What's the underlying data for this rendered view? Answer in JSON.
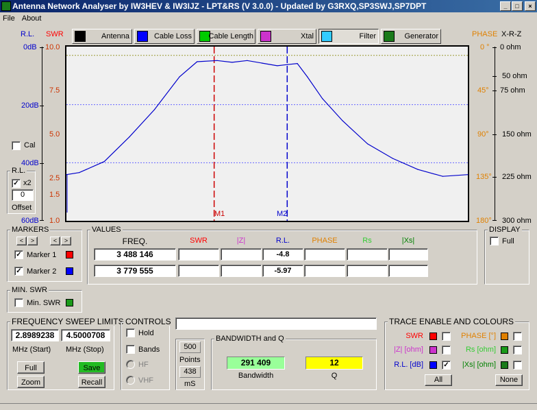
{
  "window": {
    "title": "Antenna Network Analyser by IW3HEV & IW3IJZ - LPT&RS (V 3.0.0) - Updated by G3RXQ,SP3SWJ,SP7DPT"
  },
  "window_buttons": [
    "_",
    "□",
    "×"
  ],
  "menu": [
    "File",
    "About"
  ],
  "tabs": [
    {
      "label": "Antenna",
      "icon": "antenna-icon",
      "color": "#000000"
    },
    {
      "label": "Cable Loss",
      "icon": "cable-loss-icon",
      "color": "#0000ff"
    },
    {
      "label": "Cable Length",
      "icon": "cable-length-icon",
      "color": "#00cc00"
    },
    {
      "label": "Xtal",
      "icon": "xtal-icon",
      "color": "#cc33cc"
    },
    {
      "label": "Filter",
      "icon": "filter-icon",
      "color": "#33ccff"
    },
    {
      "label": "Generator",
      "icon": "generator-icon",
      "color": "#1a7a1a"
    }
  ],
  "axes": {
    "rl_header": "R.L.",
    "swr_header": "SWR",
    "phase_header": "PHASE",
    "xrz_header": "X-R-Z",
    "rl_ticks": [
      "0dB",
      "20dB",
      "40dB",
      "60dB"
    ],
    "swr_ticks": [
      "10.0",
      "7.5",
      "5.0",
      "2.5",
      "1.5",
      "1.0"
    ],
    "phase_ticks": [
      "0 °",
      "45°",
      "90°",
      "135°",
      "180°"
    ],
    "ohm_ticks": [
      "0 ohm",
      "50 ohm",
      "75 ohm",
      "150 ohm",
      "225 ohm",
      "300 ohm"
    ]
  },
  "markers_plot": {
    "m1": "M1",
    "m2": "M2"
  },
  "cal": {
    "label": "Cal",
    "checked": false
  },
  "rl_group": {
    "title": "R.L.",
    "x2_label": "x2",
    "x2_checked": true,
    "offset_value": "0",
    "offset_label": "Offset"
  },
  "markers_group": {
    "title": "MARKERS",
    "nav": [
      "<",
      ">",
      "<",
      ">"
    ],
    "marker1": "Marker 1",
    "marker2": "Marker 2",
    "marker1_checked": true,
    "marker2_checked": true,
    "marker1_color": "#ff0000",
    "marker2_color": "#0000ff"
  },
  "values": {
    "title": "VALUES",
    "headers": [
      "FREQ.",
      "SWR",
      "|Z|",
      "R.L.",
      "PHASE",
      "Rs",
      "|Xs|"
    ],
    "header_colors": [
      "#000000",
      "#ff0000",
      "#cc33cc",
      "#0000cc",
      "#e08000",
      "#33cc33",
      "#008000"
    ],
    "rows": [
      [
        "3 488 146",
        "",
        "",
        "-4.8",
        "",
        "",
        ""
      ],
      [
        "3 779 555",
        "",
        "",
        "-5.97",
        "",
        "",
        ""
      ]
    ]
  },
  "display": {
    "title": "DISPLAY",
    "full_label": "Full",
    "full_checked": false
  },
  "min_swr": {
    "title": "MIN. SWR",
    "label": "Min. SWR",
    "checked": false,
    "color": "#1a9a1a"
  },
  "sweep": {
    "title": "FREQUENCY SWEEP LIMITS",
    "start": "2.8989238",
    "stop": "4.5000708",
    "start_label": "MHz (Start)",
    "stop_label": "MHz (Stop)",
    "full": "Full",
    "save": "Save",
    "zoom": "Zoom",
    "recall": "Recall"
  },
  "controls": {
    "title": "CONTROLS",
    "hold": "Hold",
    "bands": "Bands",
    "hf": "HF",
    "vhf": "VHF"
  },
  "points": {
    "value": "500",
    "label": "Points",
    "ms_value": "438",
    "ms_label": "mS"
  },
  "status_field": "",
  "bandwidth": {
    "title": "BANDWIDTH and Q",
    "bw_value": "291 409",
    "bw_label": "Bandwidth",
    "q_value": "12",
    "q_label": "Q"
  },
  "trace": {
    "title": "TRACE ENABLE AND COLOURS",
    "items": [
      {
        "label": "SWR",
        "color": "#ff0000",
        "checked": false,
        "label_color": "#ff0000"
      },
      {
        "label": "|Z| [ohm]",
        "color": "#cc33cc",
        "checked": false,
        "label_color": "#cc33cc"
      },
      {
        "label": "R.L. [dB]",
        "color": "#0000ff",
        "checked": true,
        "label_color": "#0000cc"
      },
      {
        "label": "PHASE [°]",
        "color": "#e08000",
        "checked": false,
        "label_color": "#e08000"
      },
      {
        "label": "Rs [ohm]",
        "color": "#1a9a1a",
        "checked": false,
        "label_color": "#33cc33"
      },
      {
        "label": "|Xs| [ohm]",
        "color": "#1a7a1a",
        "checked": false,
        "label_color": "#008000"
      }
    ],
    "all": "All",
    "none": "None"
  },
  "chart_data": {
    "type": "line",
    "x_domain": [
      2.8989238,
      4.5000708
    ],
    "ylim_rl_db": [
      -60,
      0
    ],
    "series": [
      {
        "color": "#0000cc",
        "x": [
          2.899,
          2.95,
          3.05,
          3.15,
          3.25,
          3.35,
          3.42,
          3.5,
          3.56,
          3.62,
          3.68,
          3.74,
          3.78,
          3.82,
          3.86,
          3.92,
          4.0,
          4.1,
          4.2,
          4.3,
          4.4,
          4.5
        ],
        "y": [
          -44.1,
          -43.4,
          -39.6,
          -31.1,
          -21.7,
          -10.4,
          -5.2,
          -4.8,
          -5.4,
          -4.8,
          -5.7,
          -6.6,
          -6.2,
          -5.8,
          -10.4,
          -17.9,
          -25.5,
          -33.5,
          -38.5,
          -42.3,
          -44.7,
          -44.1
        ]
      }
    ],
    "markers": [
      {
        "name": "M1",
        "x": 3.488146,
        "color": "#cc0000"
      },
      {
        "name": "M2",
        "x": 3.779555,
        "color": "#0000cc"
      }
    ],
    "ref_lines": [
      {
        "y_db": -20,
        "color": "#6666ff"
      },
      {
        "y_db": -40,
        "color": "#6666ff"
      },
      {
        "y_db": -3,
        "color": "#999933"
      }
    ]
  }
}
